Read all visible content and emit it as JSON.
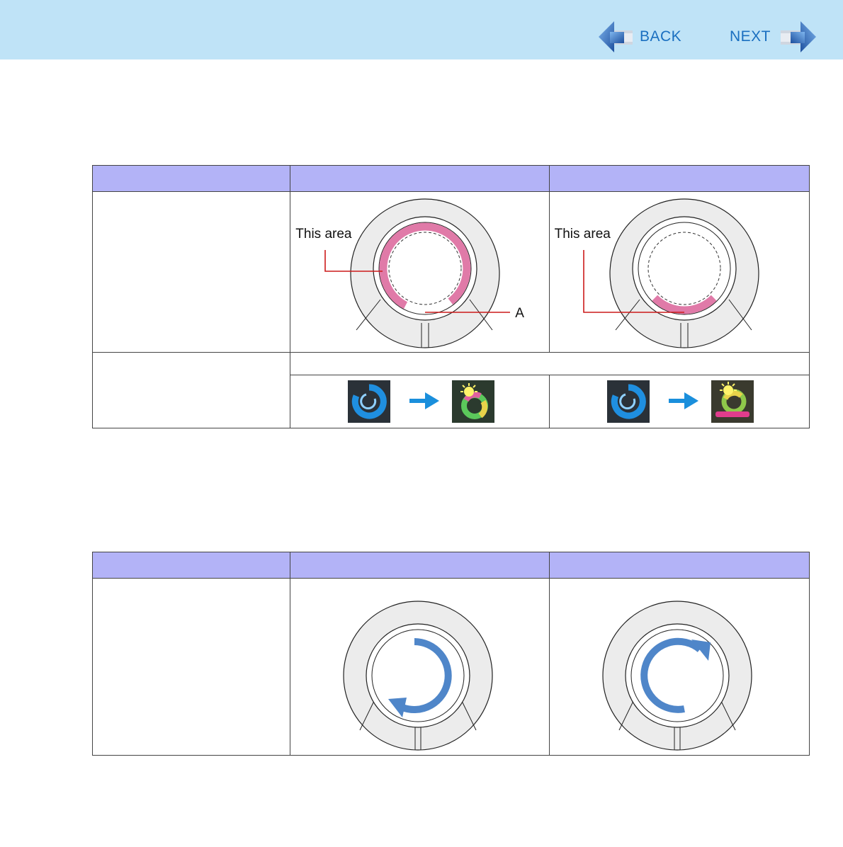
{
  "nav": {
    "back_label": "BACK",
    "next_label": "NEXT"
  },
  "table1": {
    "headers": [
      "",
      "",
      ""
    ],
    "row1_label": "",
    "cell_left": {
      "callout": "This area",
      "marker": "A"
    },
    "cell_right": {
      "callout": "This area"
    },
    "row2_label": "",
    "row2_span_text": ""
  },
  "table2": {
    "headers": [
      "",
      "",
      ""
    ],
    "row1_label": ""
  },
  "colors": {
    "topbar": "#bfe3f7",
    "header_fill": "#b3b3f7",
    "highlight": "#e07aa8",
    "rotation_arrow": "#4f86c9",
    "callout_line": "#cc1a1a",
    "link_text": "#1a6fc0"
  }
}
